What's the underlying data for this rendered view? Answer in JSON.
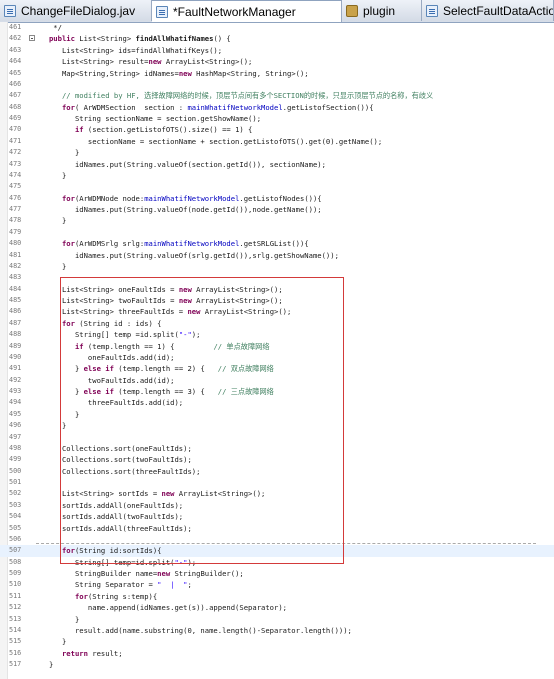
{
  "tabs": [
    {
      "label": "ChangeFileDialog.jav",
      "icon": "java-file-icon"
    },
    {
      "label": "*FaultNetworkManager",
      "icon": "java-file-icon"
    },
    {
      "label": "plugin",
      "icon": "package-icon"
    },
    {
      "label": "SelectFaultDataActio",
      "icon": "java-file-icon"
    }
  ],
  "active_tab": 1,
  "code_lines": [
    {
      "n": "461",
      "t": "    */"
    },
    {
      "n": "462",
      "t": "   public List<String> findAllWhatifNames() {"
    },
    {
      "n": "463",
      "t": "      List<String> ids=findAllWhatifKeys();"
    },
    {
      "n": "464",
      "t": "      List<String> result=new ArrayList<String>();"
    },
    {
      "n": "465",
      "t": "      Map<String,String> idNames=new HashMap<String, String>();"
    },
    {
      "n": "466",
      "t": ""
    },
    {
      "n": "467",
      "t": "      // modified by HF, 选择故障网络的时候，顶层节点间有多个SECTION的时候，只显示顶层节点的名称，有歧义"
    },
    {
      "n": "468",
      "t": "      for( ArWDMSection  section : mainWhatifNetworkModel.getListofSection()){"
    },
    {
      "n": "469",
      "t": "         String sectionName = section.getShowName();"
    },
    {
      "n": "470",
      "t": "         if (section.getListofOTS().size() == 1) {"
    },
    {
      "n": "471",
      "t": "            sectionName = sectionName + section.getListofOTS().get(0).getName();"
    },
    {
      "n": "472",
      "t": "         }"
    },
    {
      "n": "473",
      "t": "         idNames.put(String.valueOf(section.getId()), sectionName);"
    },
    {
      "n": "474",
      "t": "      }"
    },
    {
      "n": "475",
      "t": ""
    },
    {
      "n": "476",
      "t": "      for(ArWDMNode node:mainWhatifNetworkModel.getListofNodes()){"
    },
    {
      "n": "477",
      "t": "         idNames.put(String.valueOf(node.getId()),node.getName());"
    },
    {
      "n": "478",
      "t": "      }"
    },
    {
      "n": "479",
      "t": ""
    },
    {
      "n": "480",
      "t": "      for(ArWDMSrlg srlg:mainWhatifNetworkModel.getSRLGList()){"
    },
    {
      "n": "481",
      "t": "         idNames.put(String.valueOf(srlg.getId()),srlg.getShowName());"
    },
    {
      "n": "482",
      "t": "      }"
    },
    {
      "n": "483",
      "t": ""
    },
    {
      "n": "484",
      "t": "      List<String> oneFaultIds = new ArrayList<String>();"
    },
    {
      "n": "485",
      "t": "      List<String> twoFaultIds = new ArrayList<String>();"
    },
    {
      "n": "486",
      "t": "      List<String> threeFaultIds = new ArrayList<String>();"
    },
    {
      "n": "487",
      "t": "      for (String id : ids) {"
    },
    {
      "n": "488",
      "t": "         String[] temp =id.split(\"-\");"
    },
    {
      "n": "489",
      "t": "         if (temp.length == 1) {         // 单点故障网络"
    },
    {
      "n": "490",
      "t": "            oneFaultIds.add(id);"
    },
    {
      "n": "491",
      "t": "         } else if (temp.length == 2) {   // 双点故障网络"
    },
    {
      "n": "492",
      "t": "            twoFaultIds.add(id);"
    },
    {
      "n": "493",
      "t": "         } else if (temp.length == 3) {   // 三点故障网络"
    },
    {
      "n": "494",
      "t": "            threeFaultIds.add(id);"
    },
    {
      "n": "495",
      "t": "         }"
    },
    {
      "n": "496",
      "t": "      }"
    },
    {
      "n": "497",
      "t": ""
    },
    {
      "n": "498",
      "t": "      Collections.sort(oneFaultIds);"
    },
    {
      "n": "499",
      "t": "      Collections.sort(twoFaultIds);"
    },
    {
      "n": "500",
      "t": "      Collections.sort(threeFaultIds);"
    },
    {
      "n": "501",
      "t": ""
    },
    {
      "n": "502",
      "t": "      List<String> sortIds = new ArrayList<String>();"
    },
    {
      "n": "503",
      "t": "      sortIds.addAll(oneFaultIds);"
    },
    {
      "n": "504",
      "t": "      sortIds.addAll(twoFaultIds);"
    },
    {
      "n": "505",
      "t": "      sortIds.addAll(threeFaultIds);"
    },
    {
      "n": "506",
      "t": ""
    },
    {
      "n": "507",
      "t": "      for(String id:sortIds){"
    },
    {
      "n": "508",
      "t": "         String[] temp=id.split(\"-\");"
    },
    {
      "n": "509",
      "t": "         StringBuilder name=new StringBuilder();"
    },
    {
      "n": "510",
      "t": "         String Separator = \"  |  \";"
    },
    {
      "n": "511",
      "t": "         for(String s:temp){"
    },
    {
      "n": "512",
      "t": "            name.append(idNames.get(s)).append(Separator);"
    },
    {
      "n": "513",
      "t": "         }"
    },
    {
      "n": "514",
      "t": "         result.add(name.substring(0, name.length()-Separator.length()));"
    },
    {
      "n": "515",
      "t": "      }"
    },
    {
      "n": "516",
      "t": "      return result;"
    },
    {
      "n": "517",
      "t": "   }"
    }
  ],
  "colors": {
    "keyword": "#7f0055",
    "type": "#1a1a1a",
    "string": "#2a00ff",
    "comment": "#3f7f5f",
    "field": "#0000c0",
    "highlight_box": "#d33a3a"
  }
}
